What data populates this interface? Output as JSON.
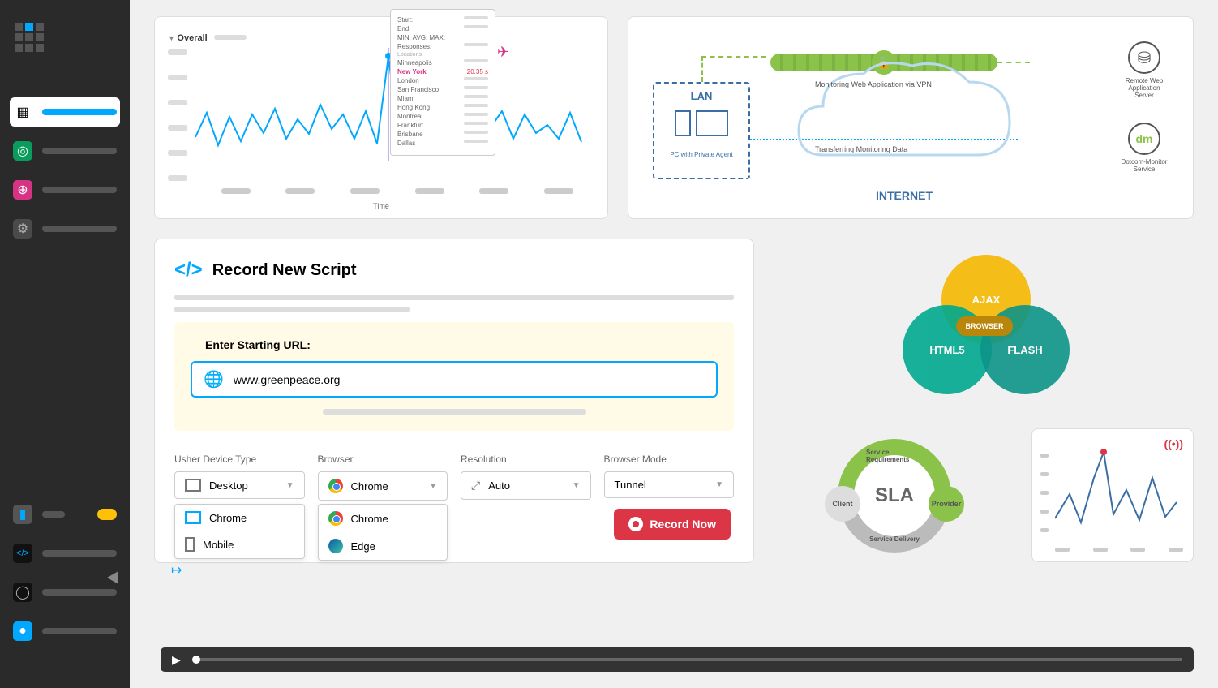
{
  "chart": {
    "title": "Overall",
    "xlabel": "Time",
    "tooltip": {
      "start": "Start:",
      "end": "End:",
      "min": "MIN:",
      "avg": "AVG:",
      "max": "MAX:",
      "responses": "Responses:",
      "locations_label": "Locations",
      "locations": [
        "Minneapolis",
        "New York",
        "London",
        "San Francisco",
        "Miami",
        "Hong Kong",
        "Montreal",
        "Frankfurt",
        "Brisbane",
        "Dallas"
      ],
      "highlight_loc": "New York",
      "highlight_val": "20.35 s"
    }
  },
  "diagram": {
    "lan": "LAN",
    "lan_sub": "PC with Private Agent",
    "monitoring": "Monitoring Web Application via VPN",
    "transfer": "Transferring Monitoring Data",
    "internet": "INTERNET",
    "remote1": "Remote Web",
    "remote2": "Application Server",
    "dm1": "Dotcom-Monitor",
    "dm2": "Service"
  },
  "record": {
    "title": "Record New Script",
    "url_label": "Enter Starting URL:",
    "url": "www.greenpeace.org",
    "opts": {
      "device_label": "Usher Device Type",
      "device_val": "Desktop",
      "device_items": [
        "Chrome",
        "Mobile"
      ],
      "browser_label": "Browser",
      "browser_val": "Chrome",
      "browser_items": [
        "Chrome",
        "Edge"
      ],
      "res_label": "Resolution",
      "res_val": "Auto",
      "mode_label": "Browser Mode",
      "mode_val": "Tunnel"
    },
    "button": "Record Now"
  },
  "venn": {
    "ajax": "AJAX",
    "html": "HTML5",
    "flash": "FLASH",
    "center": "BROWSER"
  },
  "sla": {
    "center": "SLA",
    "req": "Service Requirements",
    "del": "Service Delivery",
    "client": "Client",
    "provider": "Provider"
  },
  "chart_data": {
    "type": "line",
    "title": "Overall",
    "xlabel": "Time",
    "ylabel": "",
    "series": [
      {
        "name": "response_time_s",
        "values": [
          6,
          12,
          4,
          10,
          5,
          11,
          7,
          13,
          6,
          10,
          7,
          14,
          8,
          11,
          6,
          12,
          5,
          20.35,
          4,
          9,
          6,
          11,
          7,
          13,
          5,
          10,
          8,
          12,
          6,
          11,
          7,
          9,
          6,
          12,
          5
        ]
      }
    ],
    "highlight": {
      "index": 17,
      "location": "New York",
      "value": 20.35,
      "unit": "s"
    },
    "locations": [
      "Minneapolis",
      "New York",
      "London",
      "San Francisco",
      "Miami",
      "Hong Kong",
      "Montreal",
      "Frankfurt",
      "Brisbane",
      "Dallas"
    ]
  }
}
